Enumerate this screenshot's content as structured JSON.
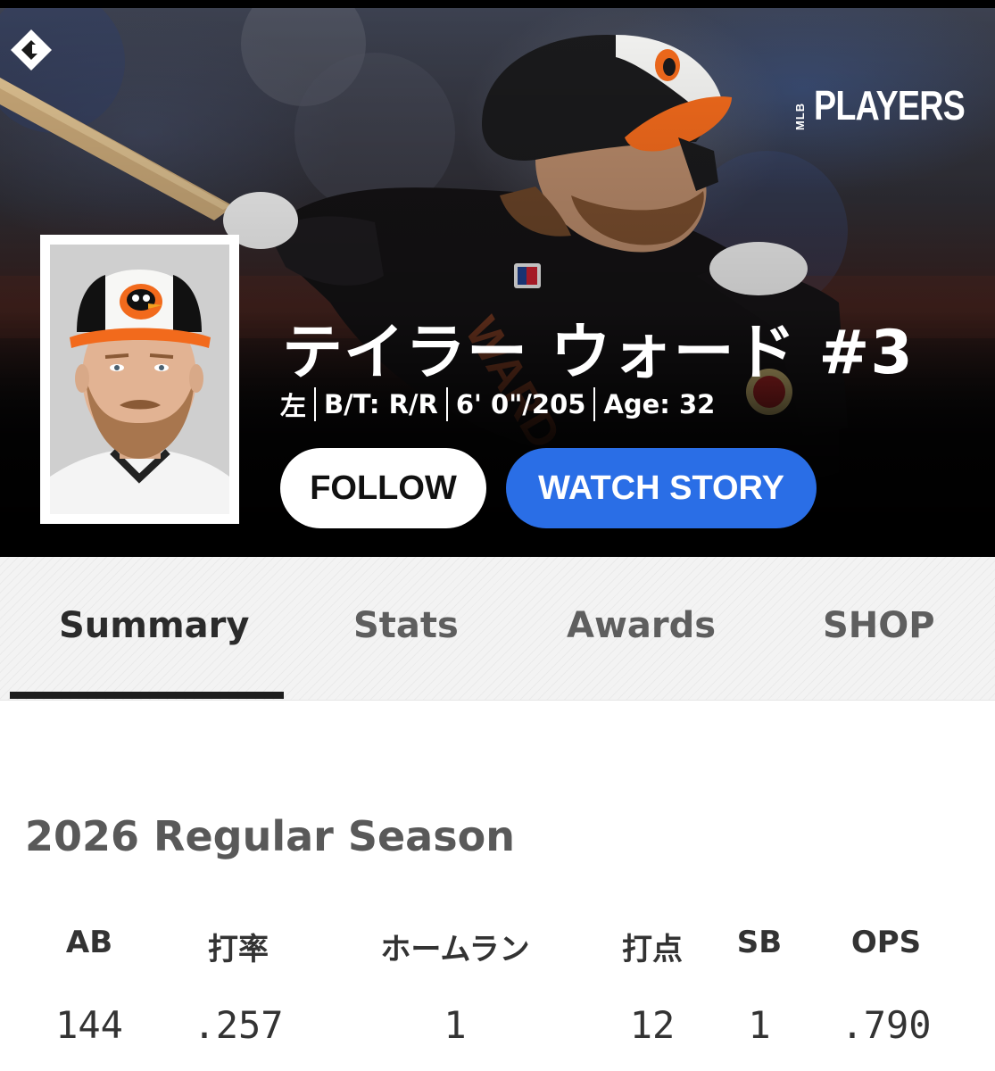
{
  "brand": {
    "logo_text": "PLAYERS",
    "logo_small": "MLB"
  },
  "player": {
    "name": "テイラー ウォード #3",
    "position": "左",
    "bats_throws": "B/T: R/R",
    "height_weight": "6' 0\"/205",
    "age": "Age: 32"
  },
  "actions": {
    "follow_label": "FOLLOW",
    "watch_label": "WATCH STORY"
  },
  "tabs": [
    {
      "label": "Summary",
      "active": true
    },
    {
      "label": "Stats",
      "active": false
    },
    {
      "label": "Awards",
      "active": false
    },
    {
      "label": "SHOP",
      "active": false
    }
  ],
  "season": {
    "title": "2026 Regular Season",
    "stats": [
      {
        "label": "AB",
        "value": "144"
      },
      {
        "label": "打率",
        "value": ".257"
      },
      {
        "label": "ホームラン",
        "value": "1"
      },
      {
        "label": "打点",
        "value": "12"
      },
      {
        "label": "SB",
        "value": "1"
      },
      {
        "label": "OPS",
        "value": ".790"
      }
    ]
  },
  "colors": {
    "watch_button": "#2a6ee6",
    "follow_button": "#ffffff",
    "team_orange": "#f26a1c"
  },
  "icons": {
    "brand_mark": "mlb-players-mark-icon"
  }
}
